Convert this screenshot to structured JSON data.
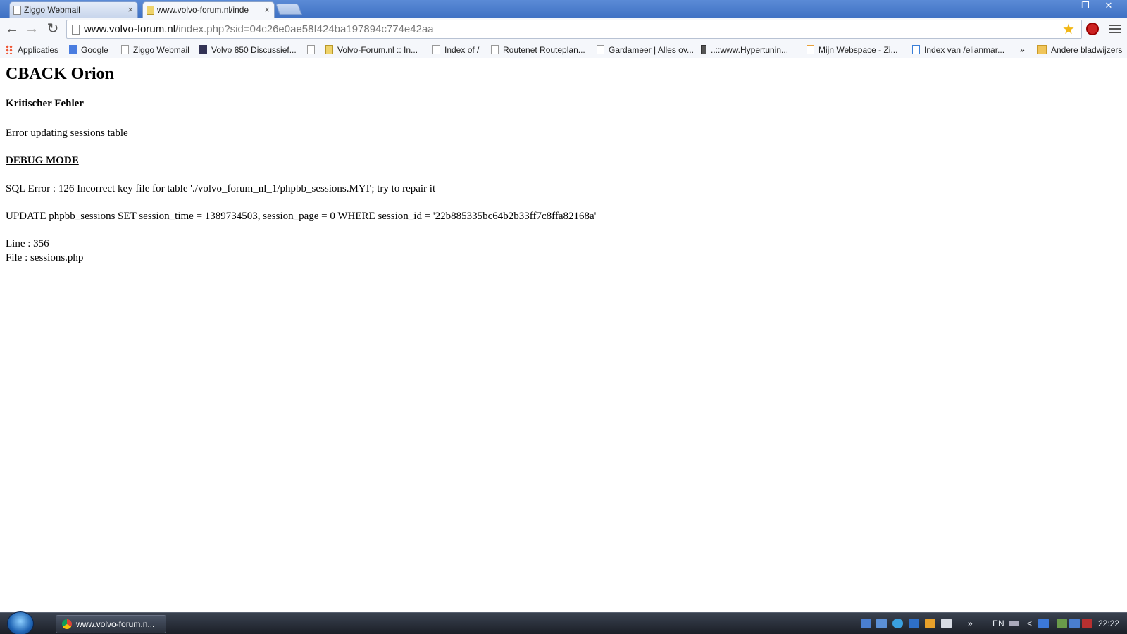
{
  "tabs": [
    {
      "label": "Ziggo Webmail",
      "active": false
    },
    {
      "label": "www.volvo-forum.nl/inde",
      "active": true
    }
  ],
  "tab_close_glyph": "×",
  "window_controls": {
    "minimize": "–",
    "restore": "❐",
    "close": "✕"
  },
  "toolbar": {
    "back": "←",
    "forward": "→",
    "reload": "↻",
    "url_host": "www.volvo-forum.nl",
    "url_path": "/index.php?sid=04c26e0ae58f424ba197894c774e42aa",
    "star": "★"
  },
  "bookmarks": [
    {
      "label": "Applicaties",
      "icon": "apps-icon"
    },
    {
      "label": "Google",
      "icon": "google-icon"
    },
    {
      "label": "Ziggo Webmail",
      "icon": "page-icon"
    },
    {
      "label": "Volvo 850 Discussief...",
      "icon": "volvo850-icon"
    },
    {
      "label": "",
      "icon": "page-icon"
    },
    {
      "label": "Volvo-Forum.nl :: In...",
      "icon": "volvo-forum-icon"
    },
    {
      "label": "Index of /",
      "icon": "page-icon"
    },
    {
      "label": "Routenet Routeplan...",
      "icon": "page-icon"
    },
    {
      "label": "Gardameer | Alles ov...",
      "icon": "page-icon"
    },
    {
      "label": "..::www.Hypertunin...",
      "icon": "hypertuning-icon"
    },
    {
      "label": "Mijn Webspace - Zi...",
      "icon": "ziggo-icon"
    },
    {
      "label": "Index van /elianmar...",
      "icon": "ziggo-blue-icon"
    }
  ],
  "bookmarks_overflow": "»",
  "other_bookmarks": "Andere bladwijzers",
  "page": {
    "title": "CBACK Orion",
    "subtitle": "Kritischer Fehler",
    "error_message": "Error updating sessions table",
    "debug_label": "DEBUG MODE",
    "sql_error": "SQL Error : 126 Incorrect key file for table './volvo_forum_nl_1/phpbb_sessions.MYI'; try to repair it",
    "sql_query": "UPDATE phpbb_sessions SET session_time = 1389734503, session_page = 0 WHERE session_id = '22b885335bc64b2b33ff7c8ffa82168a'",
    "line": "Line : 356",
    "file": "File : sessions.php"
  },
  "taskbar": {
    "window_label": "www.volvo-forum.n...",
    "tray_overflow": "»",
    "language": "EN",
    "show_hidden": "<",
    "clock": "22:22"
  },
  "colors": {
    "titlebar": "#4a7dcc",
    "star": "#f2b714",
    "taskbar": "#262b34"
  }
}
